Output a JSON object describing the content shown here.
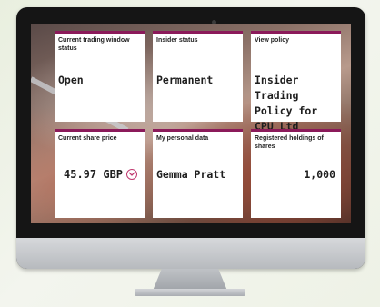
{
  "tiles": [
    {
      "label": "Current trading window status",
      "value": "Open"
    },
    {
      "label": "Insider status",
      "value": "Permanent"
    },
    {
      "label": "View policy",
      "value": "Insider Trading Policy for CPU Ltd"
    },
    {
      "label": "Current share price",
      "value": "45.97 GBP"
    },
    {
      "label": "My personal data",
      "value": "Gemma Pratt"
    },
    {
      "label": "Registered holdings of shares",
      "value": "1,000"
    }
  ],
  "icons": {
    "price_toggle": "chevron-down-icon"
  },
  "colors": {
    "accent": "#8b1a5a",
    "chevron": "#c0396f",
    "bezel": "#151515",
    "body_bg": "#eef2e6"
  }
}
